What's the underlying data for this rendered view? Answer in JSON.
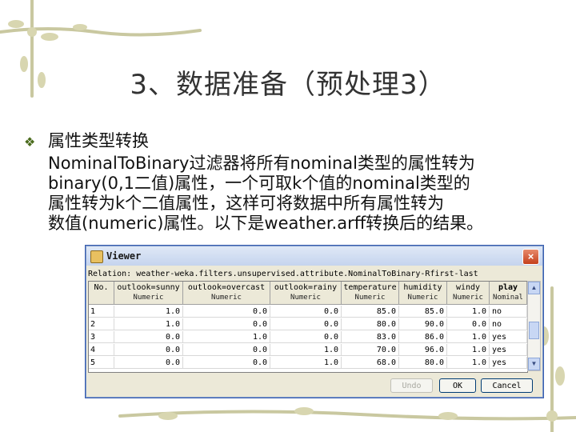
{
  "slide": {
    "title": "3、数据准备（预处理3）",
    "bullet_heading": "属性类型转换",
    "body_lines": [
      "NominalToBinary过滤器将所有nominal类型的属性转为",
      "binary(0,1二值)属性，一个可取k个值的nominal类型的",
      "属性转为k个二值属性，这样可将数据中所有属性转为",
      "数值(numeric)属性。以下是weather.arff转换后的结果。"
    ]
  },
  "viewer": {
    "title": "Viewer",
    "close_label": "×",
    "relation": "Relation: weather-weka.filters.unsupervised.attribute.NominalToBinary-Rfirst-last",
    "columns": [
      {
        "name": "No.",
        "type": ""
      },
      {
        "name": "outlook=sunny",
        "type": "Numeric"
      },
      {
        "name": "outlook=overcast",
        "type": "Numeric"
      },
      {
        "name": "outlook=rainy",
        "type": "Numeric"
      },
      {
        "name": "temperature",
        "type": "Numeric"
      },
      {
        "name": "humidity",
        "type": "Numeric"
      },
      {
        "name": "windy",
        "type": "Numeric"
      },
      {
        "name": "play",
        "type": "Nominal"
      }
    ],
    "rows": [
      [
        "1",
        "1.0",
        "0.0",
        "0.0",
        "85.0",
        "85.0",
        "1.0",
        "no"
      ],
      [
        "2",
        "1.0",
        "0.0",
        "0.0",
        "80.0",
        "90.0",
        "0.0",
        "no"
      ],
      [
        "3",
        "0.0",
        "1.0",
        "0.0",
        "83.0",
        "86.0",
        "1.0",
        "yes"
      ],
      [
        "4",
        "0.0",
        "0.0",
        "1.0",
        "70.0",
        "96.0",
        "1.0",
        "yes"
      ],
      [
        "5",
        "0.0",
        "0.0",
        "1.0",
        "68.0",
        "80.0",
        "1.0",
        "yes"
      ]
    ],
    "buttons": {
      "undo": "Undo",
      "ok": "OK",
      "cancel": "Cancel"
    }
  },
  "colors": {
    "decoration": "#c8c89a",
    "window_border": "#3a5fb0",
    "close_button": "#c4401c"
  }
}
